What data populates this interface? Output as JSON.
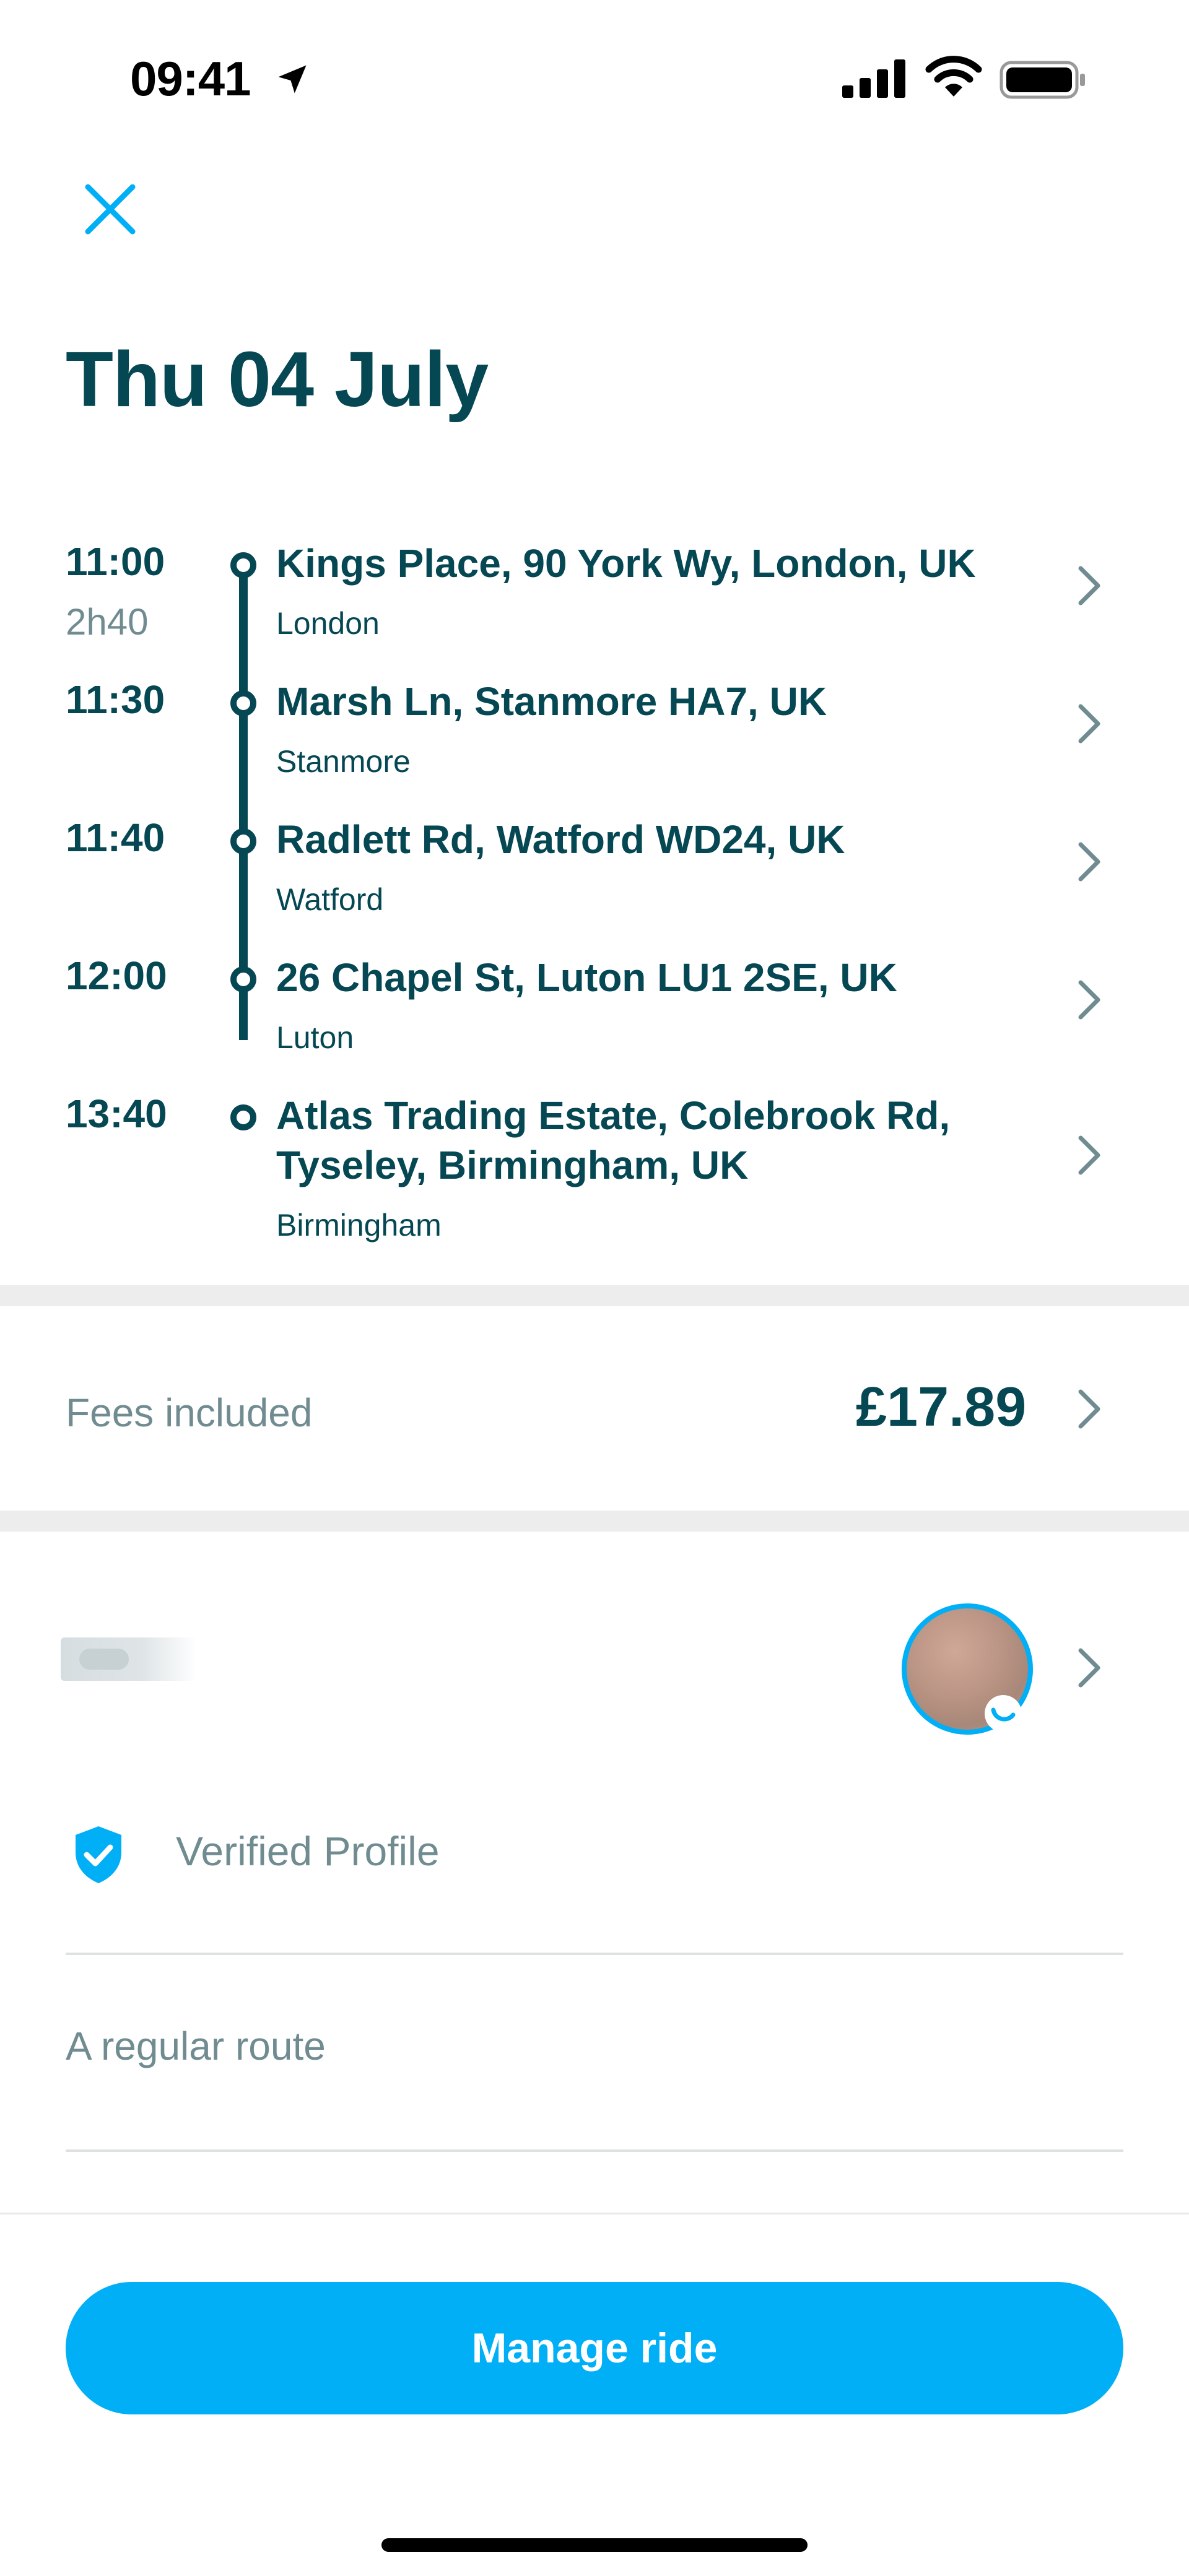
{
  "status_bar": {
    "time": "09:41",
    "icons": [
      "location-arrow-icon",
      "cellular-signal-icon",
      "wifi-icon",
      "battery-icon"
    ]
  },
  "header": {
    "close_icon": "close-icon",
    "date": "Thu 04 July"
  },
  "itinerary": {
    "duration": "2h40",
    "stops": [
      {
        "time": "11:00",
        "address": "Kings Place, 90 York Wy, London, UK",
        "city": "London"
      },
      {
        "time": "11:30",
        "address": "Marsh Ln, Stanmore HA7, UK",
        "city": "Stanmore"
      },
      {
        "time": "11:40",
        "address": "Radlett Rd, Watford WD24, UK",
        "city": "Watford"
      },
      {
        "time": "12:00",
        "address": "26 Chapel St, Luton LU1 2SE, UK",
        "city": "Luton"
      },
      {
        "time": "13:40",
        "address": "Atlas Trading Estate, Colebrook Rd, Tyseley, Birmingham, UK",
        "city": "Birmingham"
      }
    ]
  },
  "price": {
    "label": "Fees included",
    "value": "£17.89"
  },
  "driver": {
    "verified_label": "Verified Profile",
    "route_note": "A regular route"
  },
  "actions": {
    "manage_label": "Manage ride"
  },
  "colors": {
    "primary_text": "#054752",
    "secondary_text": "#708c91",
    "accent": "#00aff5",
    "separator": "#ededed"
  }
}
